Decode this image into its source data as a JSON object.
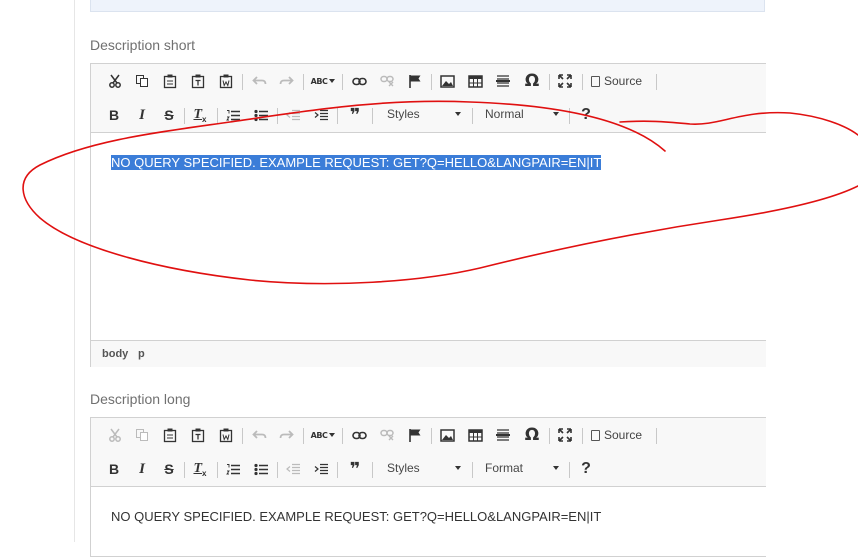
{
  "fields": {
    "short": {
      "label": "Description short",
      "content": "NO QUERY SPECIFIED. EXAMPLE REQUEST: GET?Q=HELLO&LANGPAIR=EN|IT",
      "styles_combo": "Styles",
      "format_combo": "Normal",
      "source_label": "Source",
      "path": [
        "body",
        "p"
      ]
    },
    "long": {
      "label": "Description long",
      "content": "NO QUERY SPECIFIED. EXAMPLE REQUEST: GET?Q=HELLO&LANGPAIR=EN|IT",
      "styles_combo": "Styles",
      "format_combo": "Format",
      "source_label": "Source"
    }
  },
  "toolbar_icons": [
    "cut-icon",
    "copy-icon",
    "paste-icon",
    "paste-text-icon",
    "paste-from-word-icon",
    "undo-icon",
    "redo-icon",
    "spellcheck-icon",
    "link-icon",
    "unlink-icon",
    "anchor-icon",
    "image-icon",
    "table-icon",
    "horizontal-line-icon",
    "special-char-icon",
    "maximize-icon",
    "source-icon",
    "bold-icon",
    "italic-icon",
    "strike-icon",
    "remove-format-icon",
    "numbered-list-icon",
    "bulleted-list-icon",
    "outdent-icon",
    "indent-icon",
    "blockquote-icon",
    "help-icon"
  ],
  "glyphs": {
    "italic": "I",
    "strike": "S",
    "remove_format": "T",
    "blockquote": "❞",
    "help": "?",
    "omega": "Ω",
    "spell": "ABC",
    "bold": "B"
  },
  "annotation_color": "#e01010"
}
